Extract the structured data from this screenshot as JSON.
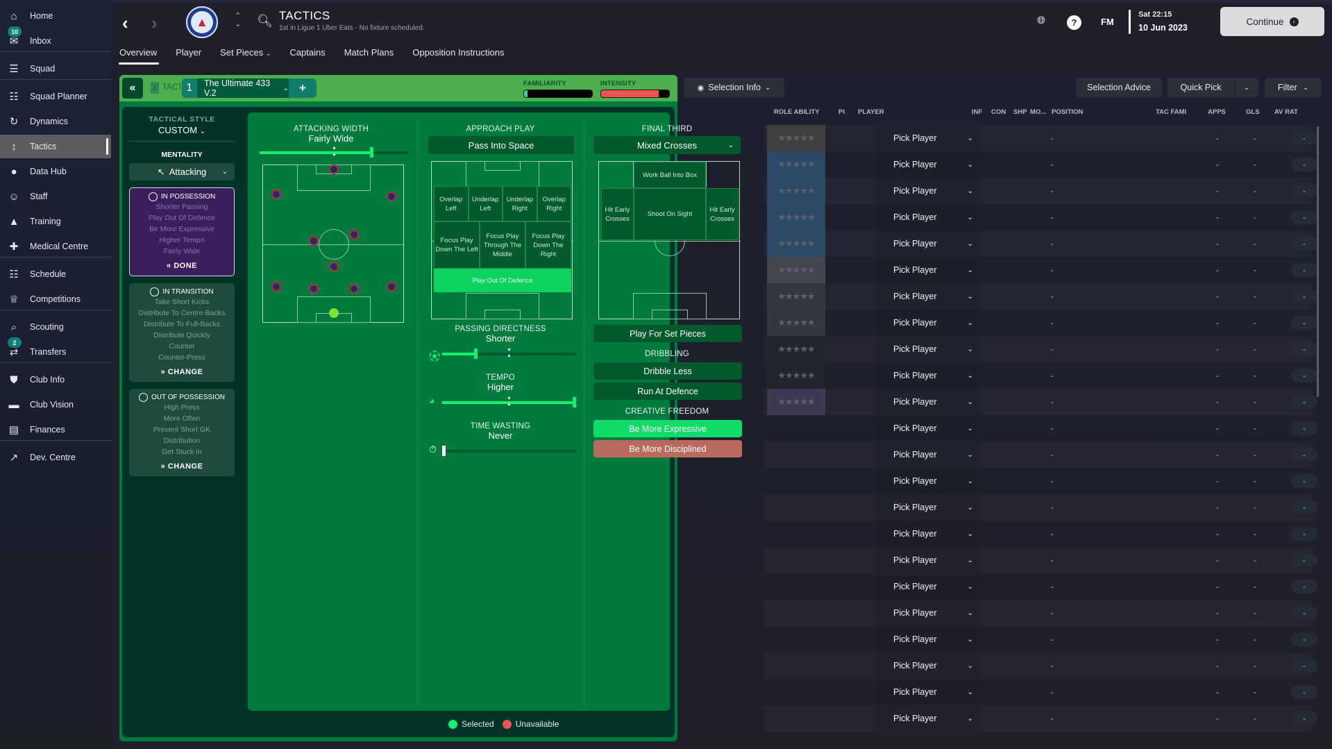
{
  "sidebar": {
    "items": [
      {
        "label": "Home",
        "icon": "home-icon"
      },
      {
        "label": "Inbox",
        "icon": "inbox-icon",
        "badge": "10"
      },
      {
        "label": "Squad",
        "icon": "shirt-icon"
      },
      {
        "label": "Squad Planner",
        "icon": "clipboard-icon"
      },
      {
        "label": "Dynamics",
        "icon": "dynamics-icon"
      },
      {
        "label": "Tactics",
        "icon": "tactics-icon",
        "active": true
      },
      {
        "label": "Data Hub",
        "icon": "data-hub-icon"
      },
      {
        "label": "Staff",
        "icon": "staff-icon"
      },
      {
        "label": "Training",
        "icon": "training-icon"
      },
      {
        "label": "Medical Centre",
        "icon": "medical-icon"
      },
      {
        "label": "Schedule",
        "icon": "calendar-icon"
      },
      {
        "label": "Competitions",
        "icon": "trophy-icon"
      },
      {
        "label": "Scouting",
        "icon": "scouting-icon"
      },
      {
        "label": "Transfers",
        "icon": "transfers-icon",
        "badge": "2"
      },
      {
        "label": "Club Info",
        "icon": "shield-icon"
      },
      {
        "label": "Club Vision",
        "icon": "briefcase-icon"
      },
      {
        "label": "Finances",
        "icon": "finances-icon"
      },
      {
        "label": "Dev. Centre",
        "icon": "dev-centre-icon"
      }
    ]
  },
  "header": {
    "title": "TACTICS",
    "subtitle": "1st in Ligue 1 Uber Eats - No fixture scheduled.",
    "club_crest": "PSG",
    "tabs": [
      "Overview",
      "Player",
      "Set Pieces",
      "Captains",
      "Match Plans",
      "Opposition Instructions"
    ],
    "active_tab": "Overview",
    "fm_label": "FM",
    "time": "Sat 22:15",
    "date": "10 Jun 2023",
    "continue_label": "Continue"
  },
  "tactics_bar": {
    "section_label": "TACTICS",
    "slot_number": "1",
    "tactic_name": "The Ultimate 433 V.2",
    "familiarity_label": "FAMILIARITY",
    "familiarity_value": 0.05,
    "intensity_label": "INTENSITY",
    "intensity_value": 0.85,
    "familiarity_color": "#43c9b0",
    "intensity_color": "#f25252"
  },
  "left_panel": {
    "tactical_style_label": "TACTICAL STYLE",
    "tactical_style_value": "CUSTOM",
    "mentality_label": "MENTALITY",
    "mentality_value": "Attacking",
    "phases": [
      {
        "title": "IN POSSESSION",
        "lines": [
          "Shorter Passing",
          "Play Out Of Defence",
          "Be More Expressive",
          "Higher Tempo",
          "Fairly Wide"
        ],
        "button": "DONE",
        "active": true
      },
      {
        "title": "IN TRANSITION",
        "lines": [
          "Take Short Kicks",
          "Distribute To Centre-Backs",
          "Distribute To Full-Backs",
          "Distribute Quickly",
          "Counter",
          "Counter-Press"
        ],
        "button": "CHANGE"
      },
      {
        "title": "OUT OF POSSESSION",
        "lines": [
          "High Press",
          "More Often",
          "Prevent Short GK",
          "Distribution",
          "Get Stuck In"
        ],
        "button": "CHANGE"
      }
    ]
  },
  "attacking_width": {
    "label": "ATTACKING WIDTH",
    "value": "Fairly Wide",
    "level": 0.75
  },
  "approach_play": {
    "label": "APPROACH PLAY",
    "value": "Pass Into Space",
    "zones_row1": [
      "Overlap Left",
      "Underlap Left",
      "Underlap Right",
      "Overlap Right"
    ],
    "zones_row2": [
      "Focus Play Down The Left",
      "Focus Play Through The Middle",
      "Focus Play Down The Right"
    ],
    "selected_zone": "Play Out Of Defence"
  },
  "passing_directness": {
    "label": "PASSING DIRECTNESS",
    "value": "Shorter",
    "level": 0.25
  },
  "tempo": {
    "label": "TEMPO",
    "value": "Higher",
    "level": 1.0
  },
  "time_wasting": {
    "label": "TIME WASTING",
    "value": "Never",
    "level": 0.0
  },
  "final_third": {
    "label": "FINAL THIRD",
    "value": "Mixed Crosses",
    "zone_top": "Work Ball Into Box",
    "zone_left": "Hit Early Crosses",
    "zone_center": "Shoot On Sight",
    "zone_right": "Hit Early Crosses",
    "set_pieces_button": "Play For Set Pieces"
  },
  "dribbling": {
    "label": "DRIBBLING",
    "options": [
      "Dribble Less",
      "Run At Defence"
    ]
  },
  "creative_freedom": {
    "label": "CREATIVE FREEDOM",
    "selected": "Be More Expressive",
    "unavailable": "Be More Disciplined"
  },
  "legend": {
    "selected": "Selected",
    "unavailable": "Unavailable",
    "selected_color": "#17f06e",
    "unavailable_color": "#f25252"
  },
  "toolbar": {
    "selection_info": "Selection Info",
    "selection_advice": "Selection Advice",
    "quick_pick": "Quick Pick",
    "filter": "Filter"
  },
  "table": {
    "columns": [
      "ROLE ABILITY",
      "PI",
      "PLAYER",
      "INF",
      "CON",
      "SHP",
      "MO...",
      "POSITION",
      "TAC FAMI",
      "APPS",
      "GLS",
      "AV RAT"
    ],
    "rows": [
      {
        "player": "Pick Player",
        "position": "-",
        "apps": "-",
        "gls": "-",
        "av_rat": "-",
        "role_color": "#423f3f"
      },
      {
        "player": "Pick Player",
        "position": "-",
        "apps": "-",
        "gls": "-",
        "av_rat": "-",
        "role_color": "#2c4a66"
      },
      {
        "player": "Pick Player",
        "position": "-",
        "apps": "-",
        "gls": "-",
        "av_rat": "-",
        "role_color": "#2c4a66"
      },
      {
        "player": "Pick Player",
        "position": "-",
        "apps": "-",
        "gls": "-",
        "av_rat": "-",
        "role_color": "#2c4a66"
      },
      {
        "player": "Pick Player",
        "position": "-",
        "apps": "-",
        "gls": "-",
        "av_rat": "-",
        "role_color": "#2c4a66"
      },
      {
        "player": "Pick Player",
        "position": "-",
        "apps": "-",
        "gls": "-",
        "av_rat": "-",
        "role_color": "#42464f"
      },
      {
        "player": "Pick Player",
        "position": "-",
        "apps": "-",
        "gls": "-",
        "av_rat": "-",
        "role_color": "#33373f"
      },
      {
        "player": "Pick Player",
        "position": "-",
        "apps": "-",
        "gls": "-",
        "av_rat": "-",
        "role_color": "#33373f"
      },
      {
        "player": "Pick Player",
        "position": "-",
        "apps": "-",
        "gls": "-",
        "av_rat": "-",
        "role_color": "#22252d"
      },
      {
        "player": "Pick Player",
        "position": "-",
        "apps": "-",
        "gls": "-",
        "av_rat": "-",
        "role_color": "#22252d"
      },
      {
        "player": "Pick Player",
        "position": "-",
        "apps": "-",
        "gls": "-",
        "av_rat": "-",
        "role_color": "#3f3852"
      },
      {
        "player": "Pick Player",
        "position": "-",
        "apps": "-",
        "gls": "-",
        "av_rat": "-"
      },
      {
        "player": "Pick Player",
        "position": "-",
        "apps": "-",
        "gls": "-",
        "av_rat": "-"
      },
      {
        "player": "Pick Player",
        "position": "-",
        "apps": "-",
        "gls": "-",
        "av_rat": "-"
      },
      {
        "player": "Pick Player",
        "position": "-",
        "apps": "-",
        "gls": "-",
        "av_rat": "-"
      },
      {
        "player": "Pick Player",
        "position": "-",
        "apps": "-",
        "gls": "-",
        "av_rat": "-"
      },
      {
        "player": "Pick Player",
        "position": "-",
        "apps": "-",
        "gls": "-",
        "av_rat": "-"
      },
      {
        "player": "Pick Player",
        "position": "-",
        "apps": "-",
        "gls": "-",
        "av_rat": "-"
      },
      {
        "player": "Pick Player",
        "position": "-",
        "apps": "-",
        "gls": "-",
        "av_rat": "-"
      },
      {
        "player": "Pick Player",
        "position": "-",
        "apps": "-",
        "gls": "-",
        "av_rat": "-"
      },
      {
        "player": "Pick Player",
        "position": "-",
        "apps": "-",
        "gls": "-",
        "av_rat": "-"
      },
      {
        "player": "Pick Player",
        "position": "-",
        "apps": "-",
        "gls": "-",
        "av_rat": "-"
      },
      {
        "player": "Pick Player",
        "position": "-",
        "apps": "-",
        "gls": "-",
        "av_rat": "-"
      }
    ]
  }
}
